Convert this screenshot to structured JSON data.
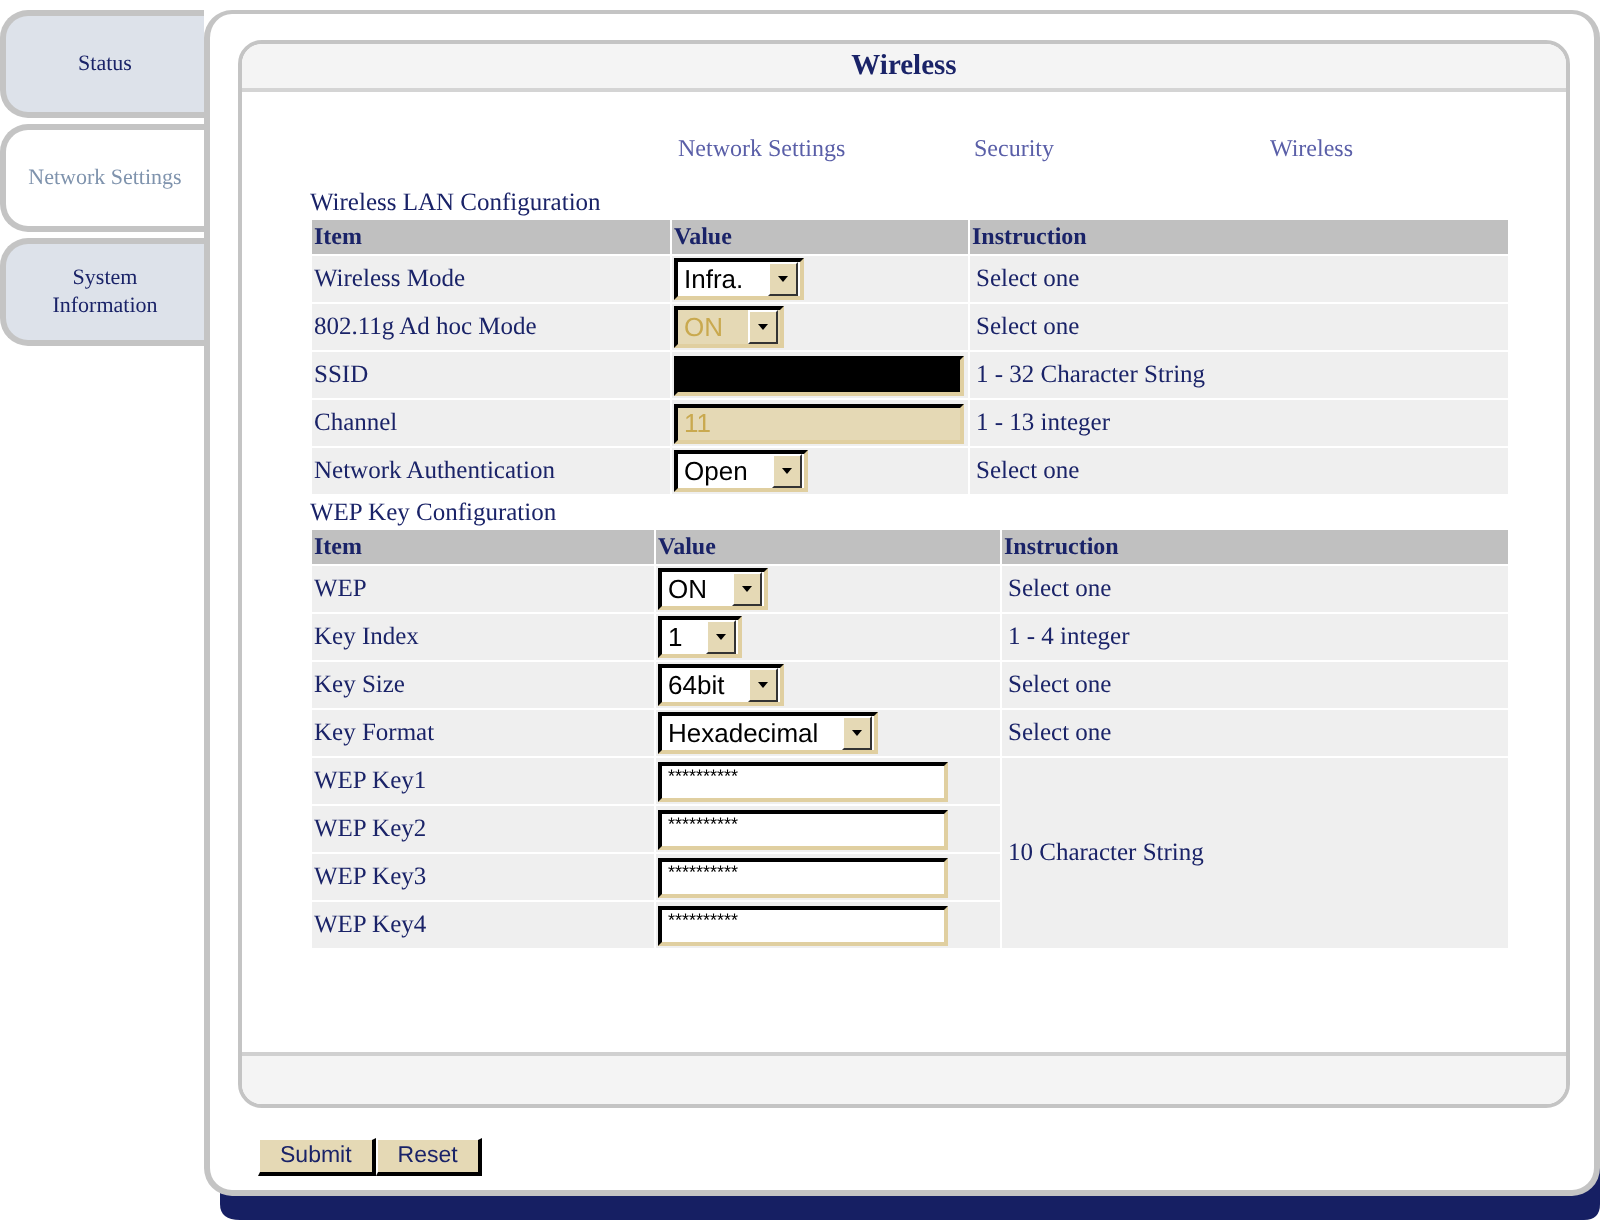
{
  "tabs": [
    {
      "label": "Status",
      "selected": false
    },
    {
      "label": "Network Settings",
      "selected": true
    },
    {
      "label": "System Information",
      "selected": false
    }
  ],
  "panel": {
    "title": "Wireless"
  },
  "links": [
    "Network Settings",
    "Security",
    "Wireless"
  ],
  "sections": [
    {
      "title": "Wireless LAN Configuration",
      "columns": [
        "Item",
        "Value",
        "Instruction"
      ],
      "rows": [
        {
          "item": "Wireless Mode",
          "control": {
            "kind": "select",
            "value": "Infra.",
            "disabled": false
          },
          "instruction": "Select one"
        },
        {
          "item": "802.11g Ad hoc Mode",
          "control": {
            "kind": "select",
            "value": "ON",
            "disabled": true
          },
          "instruction": "Select one"
        },
        {
          "item": "SSID",
          "control": {
            "kind": "blackout"
          },
          "instruction": "1 - 32 Character String"
        },
        {
          "item": "Channel",
          "control": {
            "kind": "text",
            "value": "11",
            "disabled": true
          },
          "instruction": "1 - 13 integer"
        },
        {
          "item": "Network Authentication",
          "control": {
            "kind": "select",
            "value": "Open",
            "disabled": false
          },
          "instruction": "Select one"
        }
      ]
    },
    {
      "title": "WEP Key Configuration",
      "columns": [
        "Item",
        "Value",
        "Instruction"
      ],
      "rows": [
        {
          "item": "WEP",
          "control": {
            "kind": "select",
            "value": "ON",
            "disabled": false
          },
          "instruction": "Select one"
        },
        {
          "item": "Key Index",
          "control": {
            "kind": "select",
            "value": "1",
            "disabled": false
          },
          "instruction": "1 - 4 integer"
        },
        {
          "item": "Key Size",
          "control": {
            "kind": "select",
            "value": "64bit",
            "disabled": false
          },
          "instruction": "Select one"
        },
        {
          "item": "Key Format",
          "control": {
            "kind": "select",
            "value": "Hexadecimal",
            "disabled": false
          },
          "instruction": "Select one"
        },
        {
          "item": "WEP Key1",
          "control": {
            "kind": "password",
            "value": "**********",
            "disabled": false
          },
          "instruction": "10 Character String"
        },
        {
          "item": "WEP Key2",
          "control": {
            "kind": "password",
            "value": "**********",
            "disabled": false
          }
        },
        {
          "item": "WEP Key3",
          "control": {
            "kind": "password",
            "value": "**********",
            "disabled": false
          }
        },
        {
          "item": "WEP Key4",
          "control": {
            "kind": "password",
            "value": "**********",
            "disabled": false
          }
        }
      ]
    }
  ],
  "buttons": [
    "Submit",
    "Reset"
  ]
}
